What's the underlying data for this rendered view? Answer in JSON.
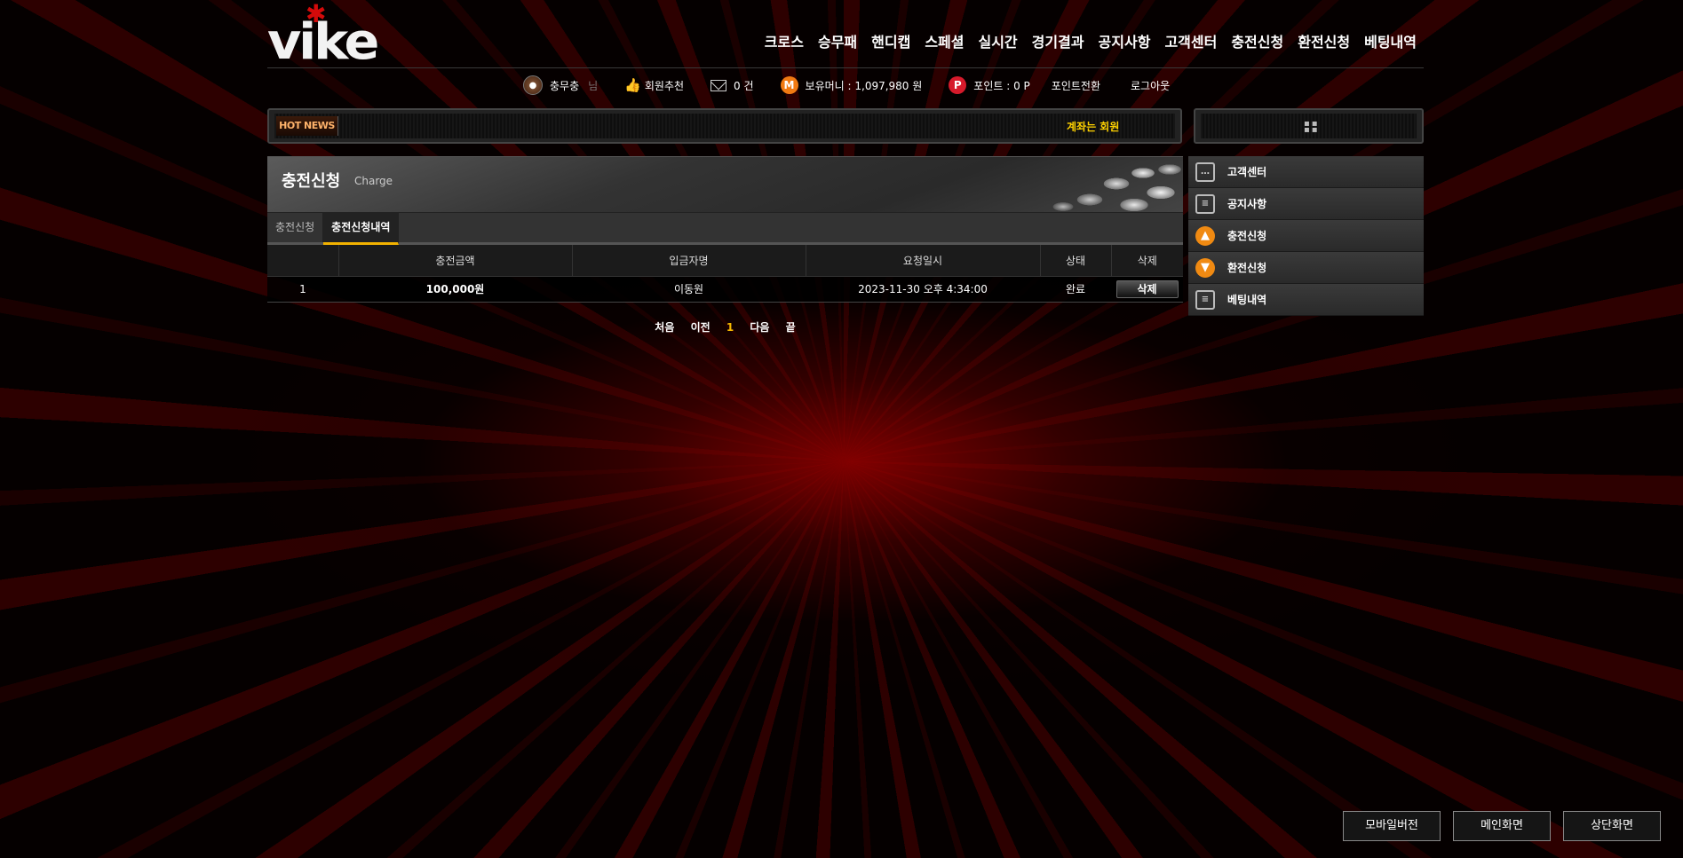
{
  "logo": {
    "text": "vike",
    "accent_color": "#d40a0a"
  },
  "topnav": [
    "크로스",
    "승무패",
    "핸디캡",
    "스페셜",
    "실시간",
    "경기결과",
    "공지사항",
    "고객센터",
    "충전신청",
    "환전신청",
    "베팅내역"
  ],
  "userbar": {
    "username": "충무충",
    "suffix": "님",
    "recommend_label": "회원추천",
    "messages": "0 건",
    "money_label": "보유머니 : 1,097,980 원",
    "points_label": "포인트 : 0 P",
    "point_convert": "포인트전환",
    "logout": "로그아웃"
  },
  "news": {
    "badge": "HOT NEWS",
    "ticker": "계좌는 회원"
  },
  "panel": {
    "title": "충전신청",
    "subtitle": "Charge",
    "tabs": [
      {
        "label": "충전신청",
        "active": false
      },
      {
        "label": "충전신청내역",
        "active": true
      }
    ],
    "columns": [
      "",
      "충전금액",
      "입금자명",
      "요청일시",
      "상태",
      "삭제"
    ],
    "rows": [
      {
        "no": "1",
        "amount": "100,000원",
        "depositor": "이동원",
        "requested": "2023-11-30 오후 4:34:00",
        "status": "완료",
        "action": "삭제"
      }
    ],
    "pager": {
      "first": "처음",
      "prev": "이전",
      "current": "1",
      "next": "다음",
      "last": "끝"
    }
  },
  "right_menu": [
    {
      "label": "고객센터",
      "icon": "chat-icon"
    },
    {
      "label": "공지사항",
      "icon": "notebook-icon"
    },
    {
      "label": "충전신청",
      "icon": "arrow-up-icon"
    },
    {
      "label": "환전신청",
      "icon": "arrow-down-icon"
    },
    {
      "label": "베팅내역",
      "icon": "notebook-icon"
    }
  ],
  "bottom_buttons": [
    "모바일버전",
    "메인화면",
    "상단화면"
  ],
  "colors": {
    "accent_yellow": "#f5b800",
    "orange": "#f08a12",
    "brand_red": "#d40a0a"
  }
}
